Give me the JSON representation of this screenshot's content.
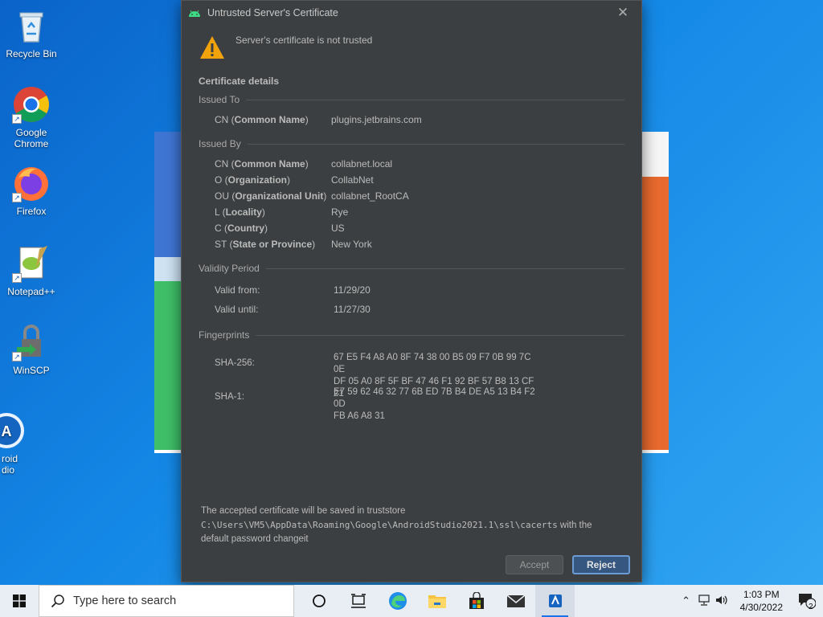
{
  "desktop": {
    "icons": [
      {
        "label": "Recycle Bin"
      },
      {
        "label": "Google Chrome"
      },
      {
        "label": "Firefox"
      },
      {
        "label": "Notepad++"
      },
      {
        "label": "WinSCP"
      },
      {
        "label": "roid\ndio"
      }
    ]
  },
  "dialog": {
    "title": "Untrusted Server's Certificate",
    "warning": "Server's certificate is not trusted",
    "section_title": "Certificate details",
    "issued_to": {
      "header": "Issued To",
      "rows": [
        {
          "abbr": "CN (",
          "name": "Common Name",
          "close": ")",
          "value": "plugins.jetbrains.com"
        }
      ]
    },
    "issued_by": {
      "header": "Issued By",
      "rows": [
        {
          "abbr": "CN (",
          "name": "Common Name",
          "close": ")",
          "value": "collabnet.local"
        },
        {
          "abbr": "O (",
          "name": "Organization",
          "close": ")",
          "value": "CollabNet"
        },
        {
          "abbr": "OU (",
          "name": "Organizational Unit",
          "close": ")",
          "value": "collabnet_RootCA"
        },
        {
          "abbr": "L (",
          "name": "Locality",
          "close": ")",
          "value": "Rye"
        },
        {
          "abbr": "C (",
          "name": "Country",
          "close": ")",
          "value": "US"
        },
        {
          "abbr": "ST (",
          "name": "State or Province",
          "close": ")",
          "value": "New York"
        }
      ]
    },
    "validity": {
      "header": "Validity Period",
      "from_label": "Valid from:",
      "from_value": "11/29/20",
      "until_label": "Valid until:",
      "until_value": "11/27/30"
    },
    "fingerprints": {
      "header": "Fingerprints",
      "sha256_label": "SHA-256:",
      "sha256_line1": "67 E5 F4 A8 A0 8F 74 38 00 B5 09 F7 0B 99 7C 0E",
      "sha256_line2": "DF 05 A0 8F 5F BF 47 46 F1 92 BF 57 B8 13 CF 21",
      "sha1_label": "SHA-1:",
      "sha1_line1": "E7 59 62 46 32 77 6B ED 7B B4 DE A5 13 B4 F2 0D",
      "sha1_line2": "FB A6 A8 31"
    },
    "footer": {
      "line1": "The accepted certificate will be saved in truststore",
      "path": "C:\\Users\\VM5\\AppData\\Roaming\\Google\\AndroidStudio2021.1\\ssl\\cacerts",
      "line2_suffix": " with the",
      "line3_prefix": "default password ",
      "password": "changeit"
    },
    "buttons": {
      "accept": "Accept",
      "reject": "Reject"
    }
  },
  "taskbar": {
    "search_placeholder": "Type here to search",
    "time": "1:03 PM",
    "date": "4/30/2022",
    "notification_count": "2"
  },
  "colors": {
    "dialog_bg": "#3c3f41",
    "primary_button": "#365880",
    "warning": "#f0a30a"
  }
}
